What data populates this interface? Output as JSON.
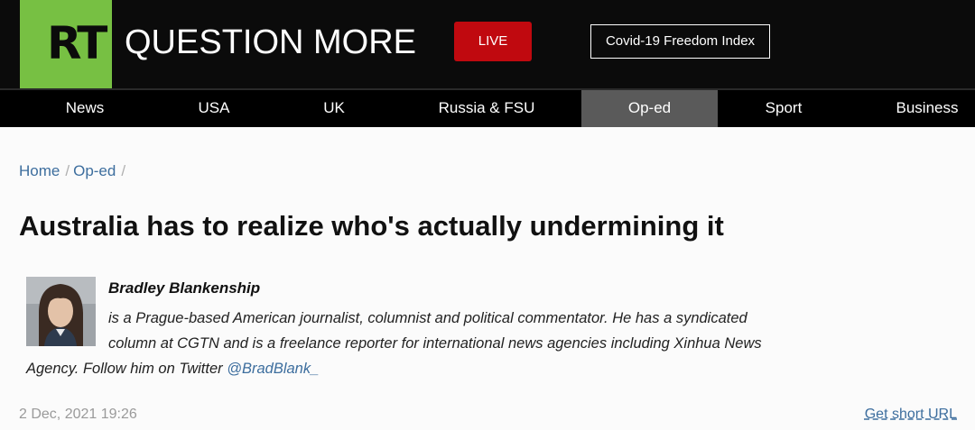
{
  "header": {
    "logo_text": "RT",
    "tagline": "QUESTION MORE",
    "live_label": "LIVE",
    "covid_label": "Covid-19 Freedom Index",
    "colors": {
      "brand_green": "#77c043",
      "live_red": "#c0090f",
      "header_bg": "#0b0b0b"
    }
  },
  "nav": {
    "items": [
      {
        "label": "News"
      },
      {
        "label": "USA"
      },
      {
        "label": "UK"
      },
      {
        "label": "Russia & FSU"
      },
      {
        "label": "Op-ed"
      },
      {
        "label": "Sport"
      },
      {
        "label": "Business"
      }
    ],
    "active": "Op-ed"
  },
  "breadcrumb": {
    "home": "Home",
    "section": "Op-ed",
    "separator": "/"
  },
  "article": {
    "title": "Australia has to realize who's actually undermining it",
    "author": {
      "name": "Bradley Blankenship",
      "bio_line1": "is a Prague-based American journalist, columnist and political commentator. He has a syndicated",
      "bio_line2": "column at CGTN and is a freelance reporter for international news agencies including Xinhua News",
      "bio_line3": "Agency. Follow him on Twitter ",
      "twitter_handle": "@BradBlank_"
    },
    "date": "2 Dec, 2021 19:26",
    "short_url_label": "Get short URL"
  }
}
